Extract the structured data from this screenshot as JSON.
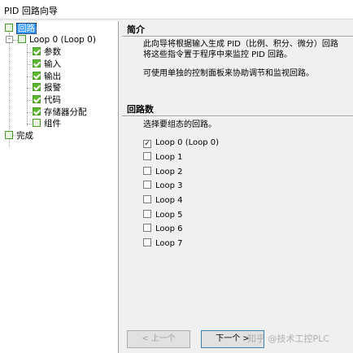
{
  "window": {
    "title": "PID 回路向导"
  },
  "tree": {
    "root_label": "回路",
    "loop_label": "Loop 0 (Loop 0)",
    "children": [
      "参数",
      "输入",
      "输出",
      "报警",
      "代码",
      "存储器分配",
      "组件"
    ],
    "finish_label": "完成",
    "expander_symbol": "-"
  },
  "intro": {
    "title": "简介",
    "line1": "此向导将根据输入生成 PID（比例、积分、微分）回路",
    "line2": "将这些指令置于程序中来监控 PID 回路。",
    "line3": "可使用单独的控制面板来协助调节和监视回路。"
  },
  "loops": {
    "title": "回路数",
    "prompt": "选择要组态的回路。",
    "options": [
      {
        "label": "Loop 0 (Loop 0)",
        "checked": true
      },
      {
        "label": "Loop 1",
        "checked": false
      },
      {
        "label": "Loop 2",
        "checked": false
      },
      {
        "label": "Loop 3",
        "checked": false
      },
      {
        "label": "Loop 4",
        "checked": false
      },
      {
        "label": "Loop 5",
        "checked": false
      },
      {
        "label": "Loop 6",
        "checked": false
      },
      {
        "label": "Loop 7",
        "checked": false
      }
    ]
  },
  "buttons": {
    "prev": "< 上一个",
    "next": "下一个 >"
  },
  "watermark": "知乎 @技术工控PLC"
}
